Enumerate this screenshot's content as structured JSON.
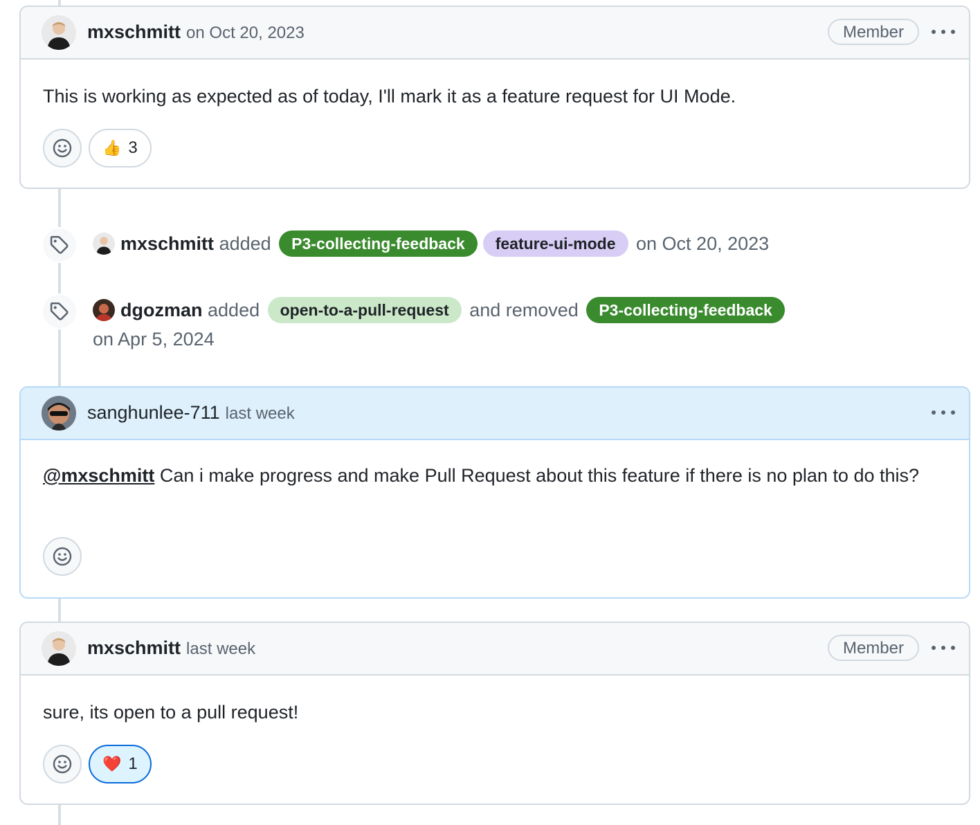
{
  "comments": [
    {
      "author": "mxschmitt",
      "time": "on Oct 20, 2023",
      "badge": "Member",
      "body": "This is working as expected as of today, I'll mark it as a feature request for UI Mode.",
      "reactions": [
        {
          "emoji": "👍",
          "count": "3"
        }
      ]
    },
    {
      "author": "sanghunlee-711",
      "time": "last week",
      "mention": "@mxschmitt",
      "body": "Can i make progress and make Pull Request about this feature if there is no plan to do this?"
    },
    {
      "author": "mxschmitt",
      "time": "last week",
      "badge": "Member",
      "body": "sure, its open to a pull request!",
      "reactions": [
        {
          "emoji": "❤️",
          "count": "1"
        }
      ]
    }
  ],
  "events": [
    {
      "user": "mxschmitt",
      "action": "added",
      "labels": [
        "P3-collecting-feedback",
        "feature-ui-mode"
      ],
      "time": "on Oct 20, 2023"
    },
    {
      "user": "dgozman",
      "action": "added",
      "added_label": "open-to-a-pull-request",
      "mid_text": "and removed",
      "removed_label": "P3-collecting-feedback",
      "time": "on Apr 5, 2024"
    }
  ],
  "colors": {
    "label_green": "#3a8a2e",
    "label_purple": "#d8cef5",
    "label_lightgreen": "#cbe8c8",
    "highlight_header": "#ddf0fb"
  },
  "icons": [
    "tag-icon",
    "smiley-icon",
    "kebab-icon"
  ]
}
